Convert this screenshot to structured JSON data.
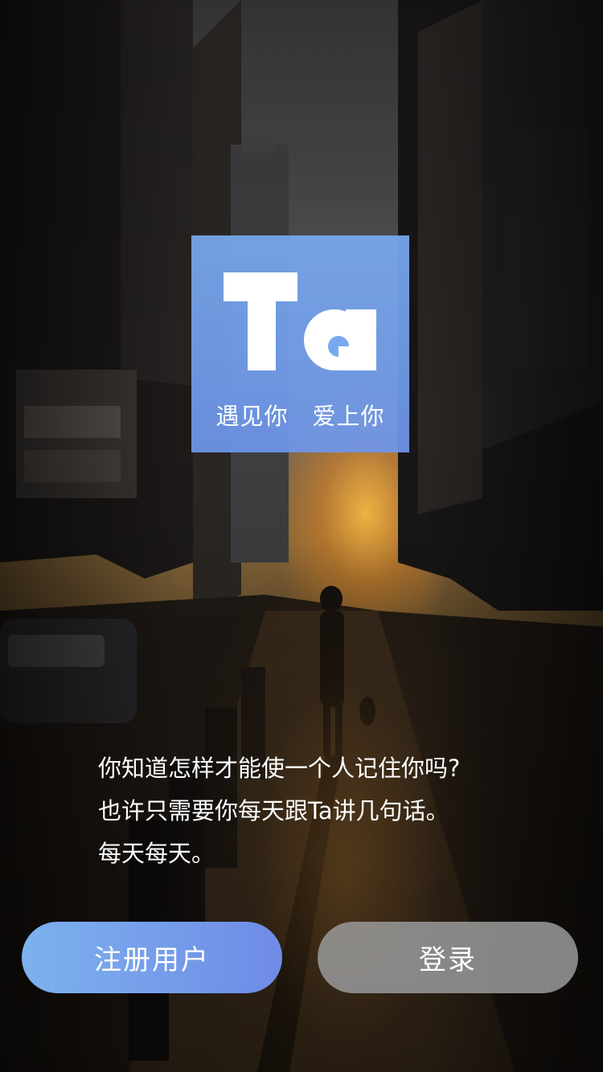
{
  "logo": {
    "tagline": "遇见你　爱上你",
    "mark": "Ta",
    "card_color": "#78a8ee"
  },
  "intro": {
    "lines": [
      "你知道怎样才能使一个人记住你吗?",
      "也许只需要你每天跟Ta讲几句话。",
      "每天每天。"
    ]
  },
  "actions": {
    "register_label": "注册用户",
    "login_label": "登录"
  },
  "colors": {
    "register_gradient_start": "#7cb2ee",
    "register_gradient_end": "#6f8be6",
    "login_bg": "#969696",
    "text": "#ffffff"
  }
}
